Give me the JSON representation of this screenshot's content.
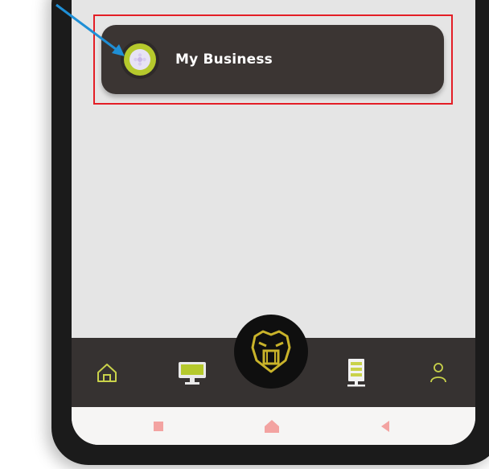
{
  "business_card": {
    "label": "My Business",
    "avatar_icon": "flower-logo-icon"
  },
  "bottom_nav": {
    "items": [
      {
        "icon": "home-icon"
      },
      {
        "icon": "monitor-icon"
      },
      {
        "icon": "bulldog-logo-icon"
      },
      {
        "icon": "server-icon"
      },
      {
        "icon": "user-icon"
      }
    ]
  },
  "android_nav": {
    "items": [
      {
        "icon": "recents-square-icon"
      },
      {
        "icon": "home-house-icon"
      },
      {
        "icon": "back-triangle-icon"
      }
    ]
  },
  "colors": {
    "accent": "#b5c92c",
    "card_bg": "#3b3533",
    "nav_bg": "#363231",
    "annotation_red": "#e41e26",
    "annotation_blue": "#1f8fd6"
  }
}
